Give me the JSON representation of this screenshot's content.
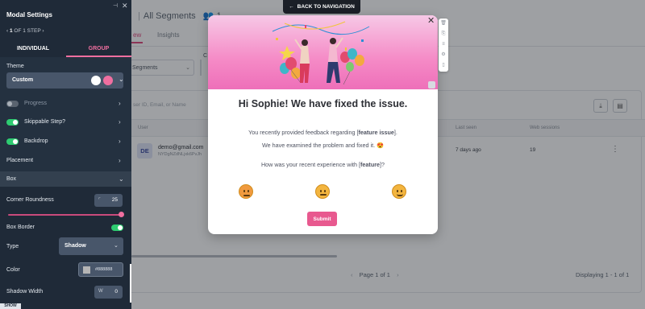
{
  "panel": {
    "title": "Modal Settings",
    "step_prefix": "1",
    "step_suffix": "OF 1 STEP",
    "tabs": {
      "individual": "INDIVIDUAL",
      "group": "GROUP"
    },
    "theme_label": "Theme",
    "theme_value": "Custom",
    "progress_label": "Progress",
    "skippable_label": "Skippable Step?",
    "backdrop_label": "Backdrop",
    "placement_label": "Placement",
    "box_label": "Box",
    "corner_label": "Corner Roundness",
    "corner_value": "25",
    "corner_level": 1.0,
    "border_label": "Box Border",
    "type_label": "Type",
    "type_value": "Shadow",
    "color_label": "Color",
    "color_value": "#888888",
    "shadow_width_label": "Shadow Width",
    "shadow_width_value": "0",
    "show_tab": "SHOW",
    "colors": {
      "accent": "#f06fa0",
      "toggle_on": "#2ecc71",
      "panel_bg": "#1f2a38"
    }
  },
  "app": {
    "breadcrumb": "All Segments",
    "count": "1",
    "tabs": [
      "ew",
      "Insights"
    ],
    "segments_select": "Segments",
    "search_placeholder": "ser ID, Email, or Name",
    "columns": [
      "User",
      "Last seen",
      "Web sessions"
    ],
    "rows": [
      {
        "avatar": "DE",
        "email": "demo@gmail.com",
        "uid": "NYDgNZdNLjxk6PvJh",
        "last_seen": "7 days ago",
        "sessions": "19"
      }
    ],
    "pager": "Page 1 of 1",
    "displaying": "Displaying 1 - 1 of 1"
  },
  "back_nav": "BACK TO NAVIGATION",
  "modal": {
    "heading": "Hi Sophie! We have fixed the issue.",
    "line1_pre": "You recently provided feedback regarding [",
    "line1_bold": "feature issue",
    "line1_post": "].",
    "line2": "We have examined the problem and fixed it. 😍",
    "line3_pre": "How was your recent experience with [",
    "line3_bold": "feature",
    "line3_post": "]?",
    "submit": "Submit"
  }
}
